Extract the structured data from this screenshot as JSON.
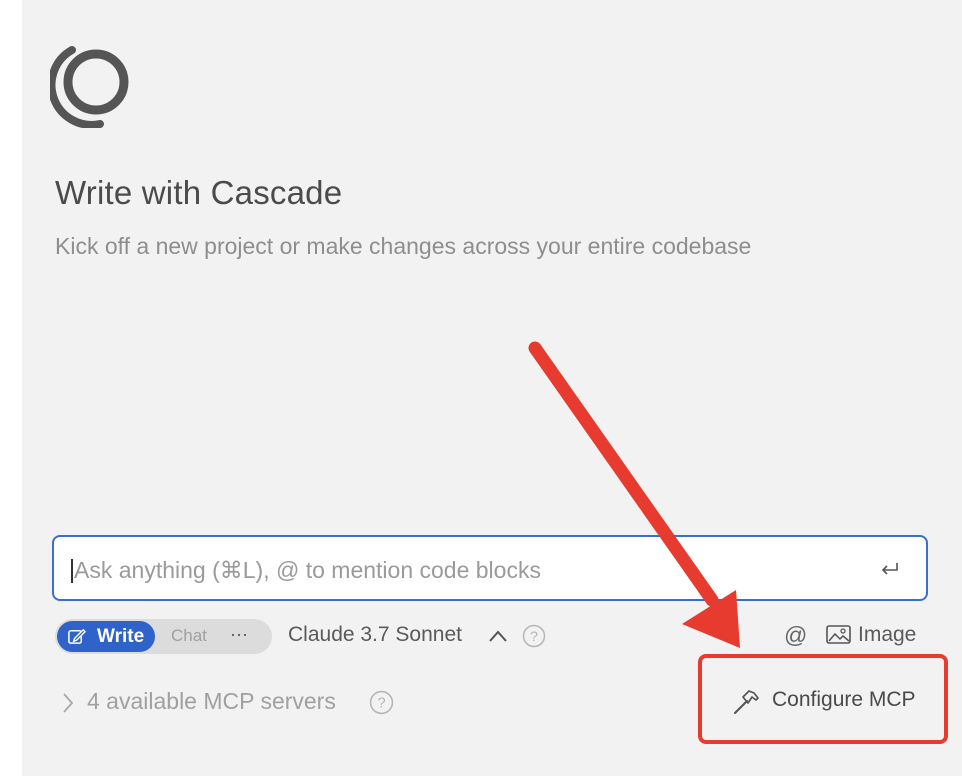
{
  "header": {
    "title": "Write with Cascade",
    "subtitle": "Kick off a new project or make changes across your entire codebase",
    "logo_icon": "cascade-logo-icon"
  },
  "input": {
    "placeholder": "Ask anything (⌘L), @ to mention code blocks",
    "value": "",
    "submit_icon": "enter-return-icon"
  },
  "mode_toggle": {
    "write_label": "Write",
    "chat_label": "Chat",
    "more_label": "···",
    "selected": "Write"
  },
  "model": {
    "label": "Claude 3.7 Sonnet",
    "chevron_icon": "chevron-up-icon",
    "help_icon": "help-circle-icon"
  },
  "input_actions": {
    "mention_label": "@",
    "image_label": "Image"
  },
  "mcp": {
    "servers_label": "4 available MCP servers",
    "configure_label": "Configure MCP",
    "configure_icon": "hammer-icon"
  },
  "colors": {
    "accent": "#2f63c9",
    "input_border": "#3a6fd0",
    "annotation": "#e63b2e",
    "panel_bg": "#f2f2f2"
  }
}
